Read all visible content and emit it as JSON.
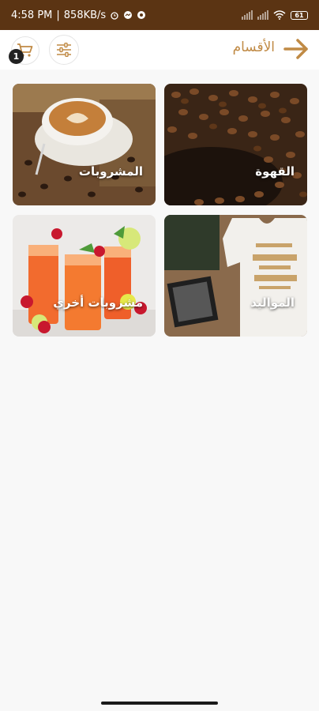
{
  "status_bar": {
    "time": "4:58 PM",
    "speed": "858KB/s",
    "battery": "61"
  },
  "header": {
    "title": "الأقسام",
    "cart_count": "1"
  },
  "categories": [
    {
      "label": "القهوة"
    },
    {
      "label": "المشروبات"
    },
    {
      "label": "المواليد"
    },
    {
      "label": "مشروبات أخري"
    }
  ],
  "colors": {
    "status_bar": "#5b3413",
    "accent": "#c08a45",
    "badge": "#222222"
  }
}
